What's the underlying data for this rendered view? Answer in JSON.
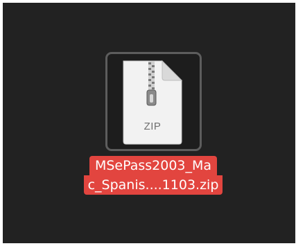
{
  "desktop": {
    "background_color": "#222222"
  },
  "file": {
    "icon": "zip-archive-icon",
    "icon_label": "ZIP",
    "name_line_1": "MSePass2003_Ma",
    "name_line_2": "c_Spanis....1103.zip",
    "selected": true,
    "selection_color": "#e2453f"
  }
}
